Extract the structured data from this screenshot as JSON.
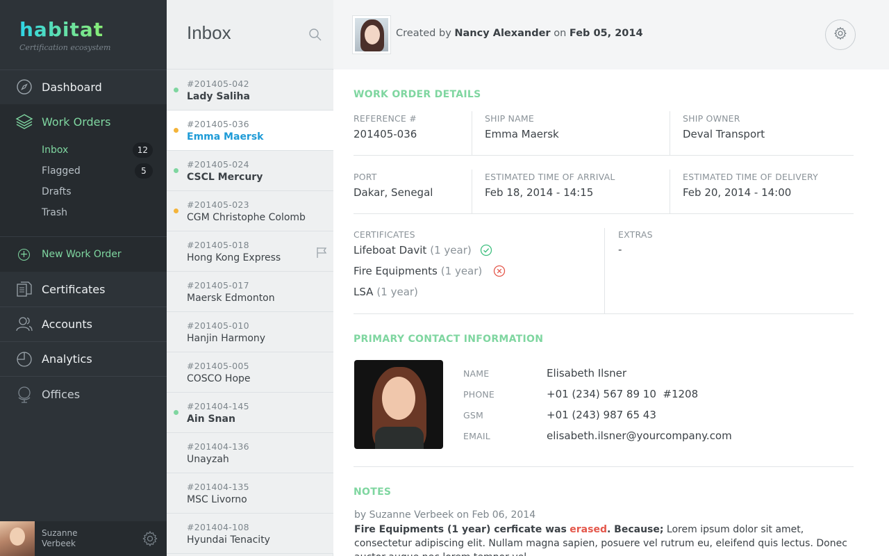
{
  "brand": {
    "logo_text": "habitat",
    "tagline": "Certification ecosystem"
  },
  "sidebar": {
    "nav": [
      {
        "label": "Dashboard",
        "icon": "compass-icon"
      },
      {
        "label": "Work Orders",
        "icon": "layers-icon"
      },
      {
        "label": "Certificates",
        "icon": "documents-icon"
      },
      {
        "label": "Accounts",
        "icon": "users-icon"
      },
      {
        "label": "Analytics",
        "icon": "pie-chart-icon"
      },
      {
        "label": "Offices",
        "icon": "globe-icon"
      }
    ],
    "work_orders_sub": [
      {
        "label": "Inbox",
        "count": "12"
      },
      {
        "label": "Flagged",
        "count": "5"
      },
      {
        "label": "Drafts",
        "count": ""
      },
      {
        "label": "Trash",
        "count": ""
      }
    ],
    "new_order_label": "New Work Order",
    "user": {
      "first": "Suzanne",
      "last": "Verbeek"
    }
  },
  "inbox": {
    "title": "Inbox",
    "items": [
      {
        "ref": "#201405-042",
        "ship": "Lady Saliha",
        "status": "green",
        "bold": true
      },
      {
        "ref": "#201405-036",
        "ship": "Emma Maersk",
        "status": "orange",
        "bold": true,
        "selected": true
      },
      {
        "ref": "#201405-024",
        "ship": "CSCL Mercury",
        "status": "green",
        "bold": true
      },
      {
        "ref": "#201405-023",
        "ship": "CGM Christophe Colomb",
        "status": "orange",
        "bold": false
      },
      {
        "ref": "#201405-018",
        "ship": "Hong Kong Express",
        "status": "",
        "bold": false,
        "flag": true
      },
      {
        "ref": "#201405-017",
        "ship": "Maersk Edmonton",
        "status": "",
        "bold": false
      },
      {
        "ref": "#201405-010",
        "ship": "Hanjin Harmony",
        "status": "",
        "bold": false
      },
      {
        "ref": "#201405-005",
        "ship": "COSCO Hope",
        "status": "",
        "bold": false
      },
      {
        "ref": "#201404-145",
        "ship": "Ain Snan",
        "status": "green",
        "bold": true
      },
      {
        "ref": "#201404-136",
        "ship": "Unayzah",
        "status": "",
        "bold": false
      },
      {
        "ref": "#201404-135",
        "ship": "MSC Livorno",
        "status": "",
        "bold": false
      },
      {
        "ref": "#201404-108",
        "ship": "Hyundai Tenacity",
        "status": "",
        "bold": false
      }
    ]
  },
  "header": {
    "created_by_prefix": "Created by",
    "creator": "Nancy Alexander",
    "on_word": "on",
    "date": "Feb 05, 2014"
  },
  "details": {
    "section_title": "WORK ORDER DETAILS",
    "reference_label": "REFERENCE #",
    "reference": "201405-036",
    "ship_name_label": "SHIP NAME",
    "ship_name": "Emma Maersk",
    "ship_owner_label": "SHIP OWNER",
    "ship_owner": "Deval Transport",
    "port_label": "PORT",
    "port": "Dakar, Senegal",
    "eta_label": "ESTIMATED TIME OF ARRIVAL",
    "eta": "Feb 18, 2014 - 14:15",
    "etd_label": "ESTIMATED TIME OF DELIVERY",
    "etd": "Feb 20, 2014 - 14:00",
    "certificates_label": "CERTIFICATES",
    "certificates": [
      {
        "name": "Lifeboat Davit",
        "duration": "(1 year)",
        "status": "ok"
      },
      {
        "name": "Fire Equipments",
        "duration": "(1 year)",
        "status": "error"
      },
      {
        "name": "LSA",
        "duration": "(1 year)",
        "status": ""
      }
    ],
    "extras_label": "EXTRAS",
    "extras": "-"
  },
  "contact": {
    "section_title": "PRIMARY CONTACT INFORMATION",
    "name_label": "NAME",
    "name": "Elisabeth Ilsner",
    "phone_label": "PHONE",
    "phone": "+01 (234) 567 89 10  #1208",
    "gsm_label": "GSM",
    "gsm": "+01 (243) 987 65 43",
    "email_label": "EMAIL",
    "email": "elisabeth.ilsner@yourcompany.com"
  },
  "notes": {
    "section_title": "NOTES",
    "meta": "by Suzanne Verbeek on Feb 06, 2014",
    "lead": "Fire Equipments (1 year) cerficate was",
    "erased": "erased",
    "because": ". Because;",
    "body": " Lorem ipsum dolor sit amet, consectetur adipiscing elit. Nullam magna sapien, posuere vel rutrum eu, eleifend quis lectus. Donec auctor augue nec lorem tempor vel"
  },
  "colors": {
    "accent": "#7fd6a0",
    "sidebar_bg": "#2d3338",
    "link_blue": "#1e9bd7",
    "error_red": "#e4574b",
    "warning_orange": "#f4b43a"
  }
}
